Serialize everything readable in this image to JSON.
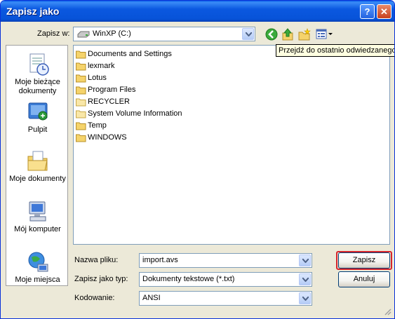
{
  "window": {
    "title": "Zapisz jako"
  },
  "save_in": {
    "label": "Zapisz w:",
    "value": "WinXP (C:)"
  },
  "toolbar": {
    "icons": [
      "back-icon",
      "up-folder-icon",
      "new-folder-icon",
      "view-menu-icon"
    ],
    "tooltip": "Przejdź do ostatnio odwiedzanego f"
  },
  "places": [
    {
      "label_lines": [
        "Moje bieżące",
        "dokumenty"
      ],
      "icon": "recent-documents-icon"
    },
    {
      "label_lines": [
        "Pulpit"
      ],
      "icon": "desktop-icon"
    },
    {
      "label_lines": [
        "Moje dokumenty"
      ],
      "icon": "my-documents-icon"
    },
    {
      "label_lines": [
        "Mój komputer"
      ],
      "icon": "my-computer-icon"
    },
    {
      "label_lines": [
        "Moje miejsca"
      ],
      "icon": "network-places-icon"
    }
  ],
  "files": [
    "Documents and Settings",
    "lexmark",
    "Lotus",
    "Program Files",
    "RECYCLER",
    "System Volume Information",
    "Temp",
    "WINDOWS"
  ],
  "filename": {
    "label": "Nazwa pliku:",
    "value": "import.avs"
  },
  "filetype": {
    "label": "Zapisz jako typ:",
    "value": "Dokumenty tekstowe (*.txt)"
  },
  "encoding": {
    "label": "Kodowanie:",
    "value": "ANSI"
  },
  "buttons": {
    "save": "Zapisz",
    "cancel": "Anuluj"
  },
  "colors": {
    "title_bar": "#0753D8",
    "window_bg": "#ECE9D8",
    "highlight_outline": "#D7262C",
    "folder": "#F5D36B"
  }
}
